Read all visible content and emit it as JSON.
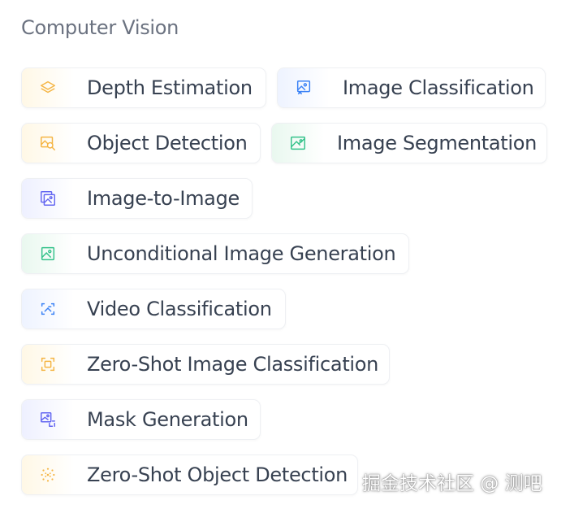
{
  "section": {
    "title": "Computer Vision"
  },
  "tags": [
    {
      "label": "Depth Estimation",
      "icon": "layers-icon",
      "color": "#f5b544"
    },
    {
      "label": "Image Classification",
      "icon": "image-classification-icon",
      "color": "#3b82f6"
    },
    {
      "label": "Object Detection",
      "icon": "object-detection-icon",
      "color": "#f5b544"
    },
    {
      "label": "Image Segmentation",
      "icon": "image-segmentation-icon",
      "color": "#34c28a"
    },
    {
      "label": "Image-to-Image",
      "icon": "image-to-image-icon",
      "color": "#6366f1"
    },
    {
      "label": "Unconditional Image Generation",
      "icon": "image-generation-icon",
      "color": "#34c28a"
    },
    {
      "label": "Video Classification",
      "icon": "video-classification-icon",
      "color": "#3b82f6"
    },
    {
      "label": "Zero-Shot Image Classification",
      "icon": "zero-shot-classification-icon",
      "color": "#f5b544"
    },
    {
      "label": "Mask Generation",
      "icon": "mask-generation-icon",
      "color": "#6366f1"
    },
    {
      "label": "Zero-Shot Object Detection",
      "icon": "zero-shot-detection-icon",
      "color": "#f5b544"
    }
  ],
  "watermark": {
    "text": "掘金技术社区 @ 测吧"
  }
}
